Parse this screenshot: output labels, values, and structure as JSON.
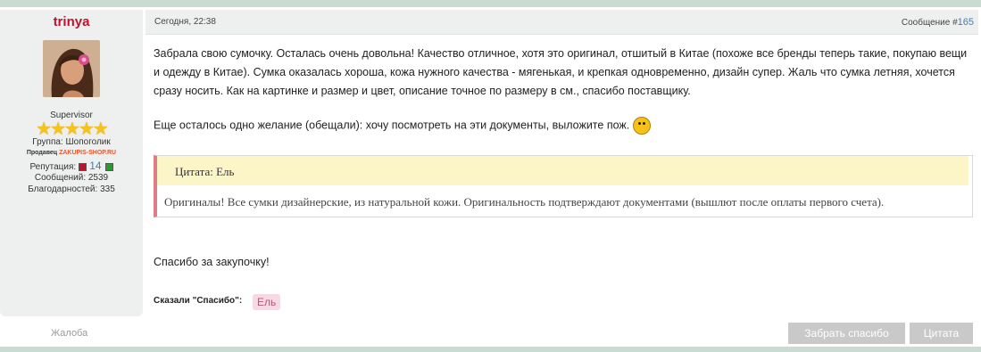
{
  "post": {
    "username": "trinya",
    "date": "Сегодня, 22:38",
    "number_label": "Сообщение #",
    "number": "165"
  },
  "user": {
    "rank": "Supervisor",
    "stars": "★★★★★",
    "group": "Группа: Шопоголик",
    "seller_prefix": "Продавец ",
    "seller_shop": "ZAKUPIS-SHOP.RU",
    "reputation_label": "Репутация:",
    "reputation_value": "14",
    "messages": "Сообщений: 2539",
    "gratitude": "Благодарностей: 335"
  },
  "message": {
    "paragraph1": "Забрала свою сумочку. Осталась очень довольна! Качество отличное, хотя это оригинал, отшитый в Китае (похоже все бренды теперь такие, покупаю вещи и одежду в Китае). Сумка оказалась хороша, кожа нужного качества - мягенькая, и крепкая одновременно, дизайн супер. Жаль что сумка летняя, хочется сразу носить.  Как на картинке и размер и цвет, описание точное по размеру в см., спасибо поставщику.",
    "paragraph2": "Еще осталось одно желание (обещали): хочу посмотреть на эти документы, выложите пож.",
    "quote_title": "Цитата: Ель",
    "quote_text": "Оригиналы! Все сумки дизайнерские, из натуральной кожи. Оригинальность подтверждают документами (вышлют после оплаты первого счета).",
    "closing": "Спасибо за закупочку!"
  },
  "thanks": {
    "label": "Сказали \"Спасибо\":",
    "names": [
      "Ель"
    ]
  },
  "actions": {
    "complain": "Жалоба",
    "thanks_button": "Забрать спасибо",
    "quote_button": "Цитата"
  },
  "colors": {
    "username": "#c0122f",
    "accent_link": "#3b7fc4",
    "quote_border": "#e07b8a",
    "quote_bg": "#fcf5c8",
    "stars": "#f5c41c",
    "button_bg": "#c9c9c9"
  }
}
